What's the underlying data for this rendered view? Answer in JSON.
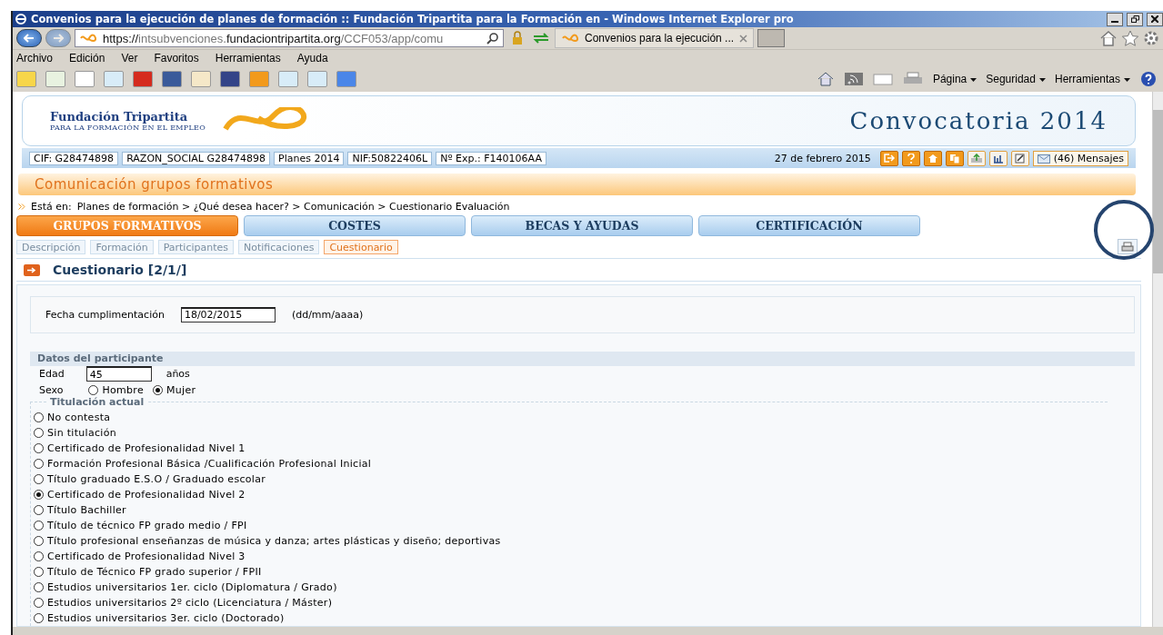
{
  "window": {
    "title": "Convenios para la ejecución de planes de formación :: Fundación Tripartita para la Formación en - Windows Internet Explorer pro"
  },
  "address_bar": {
    "segments": [
      {
        "text": "https://",
        "dim": false
      },
      {
        "text": "intsubvenciones.",
        "dim": true
      },
      {
        "text": "fundaciontripartita.org",
        "dim": false
      },
      {
        "text": "/CCF053/app/comu",
        "dim": true
      }
    ]
  },
  "browser_tab": {
    "title": "Convenios para la ejecución ..."
  },
  "menu_bar": [
    "Archivo",
    "Edición",
    "Ver",
    "Favoritos",
    "Herramientas",
    "Ayuda"
  ],
  "command_bar": [
    "Página",
    "Seguridad",
    "Herramientas"
  ],
  "header": {
    "org_name": "Fundación Tripartita",
    "org_subtitle": "PARA LA FORMACIÓN EN EL EMPLEO",
    "banner_title": "Convocatoria 2014"
  },
  "info_bar": {
    "fields": [
      "CIF: G28474898",
      "RAZON_SOCIAL G28474898",
      "Planes 2014",
      "NIF:50822406L",
      "Nº Exp.: F140106AA"
    ],
    "date": "27 de febrero 2015",
    "messages": "(46) Mensajes"
  },
  "section_title": "Comunicación grupos formativos",
  "breadcrumb": {
    "label": "Está en:",
    "path": "Planes de formación > ¿Qué desea hacer? > Comunicación > Cuestionario Evaluación"
  },
  "main_tabs": [
    {
      "label": "GRUPOS FORMATIVOS",
      "selected": true
    },
    {
      "label": "COSTES",
      "selected": false
    },
    {
      "label": "BECAS Y AYUDAS",
      "selected": false
    },
    {
      "label": "CERTIFICACIÓN",
      "selected": false
    }
  ],
  "sub_tabs": [
    {
      "label": "Descripción",
      "selected": false
    },
    {
      "label": "Formación",
      "selected": false
    },
    {
      "label": "Participantes",
      "selected": false
    },
    {
      "label": "Notificaciones",
      "selected": false
    },
    {
      "label": "Cuestionario",
      "selected": true
    }
  ],
  "panel": {
    "title": "Cuestionario [2/1/]"
  },
  "date_field": {
    "label": "Fecha cumplimentación",
    "value": "18/02/2015",
    "hint": "(dd/mm/aaaa)"
  },
  "participant": {
    "title": "Datos del participante",
    "age_label": "Edad",
    "age_value": "45",
    "age_unit": "años",
    "sex_label": "Sexo",
    "sex_options": [
      {
        "label": "Hombre",
        "selected": false
      },
      {
        "label": "Mujer",
        "selected": true
      }
    ]
  },
  "qualification": {
    "legend": "Titulación actual",
    "options": [
      {
        "label": "No contesta",
        "selected": false
      },
      {
        "label": "Sin titulación",
        "selected": false
      },
      {
        "label": "Certificado de Profesionalidad Nivel 1",
        "selected": false
      },
      {
        "label": "Formación Profesional Básica /Cualificación Profesional Inicial",
        "selected": false
      },
      {
        "label": "Título graduado E.S.O / Graduado escolar",
        "selected": false
      },
      {
        "label": "Certificado de Profesionalidad Nivel 2",
        "selected": true
      },
      {
        "label": "Título Bachiller",
        "selected": false
      },
      {
        "label": "Título de técnico FP grado medio / FPI",
        "selected": false
      },
      {
        "label": "Título profesional enseñanzas de música y danza; artes plásticas y diseño; deportivas",
        "selected": false
      },
      {
        "label": "Certificado de Profesionalidad Nivel 3",
        "selected": false
      },
      {
        "label": "Título de Técnico FP grado superior / FPII",
        "selected": false
      },
      {
        "label": "Estudios universitarios 1er. ciclo (Diplomatura / Grado)",
        "selected": false
      },
      {
        "label": "Estudios universitarios 2º ciclo (Licenciatura / Máster)",
        "selected": false
      },
      {
        "label": "Estudios universitarios 3er. ciclo (Doctorado)",
        "selected": false
      }
    ]
  }
}
